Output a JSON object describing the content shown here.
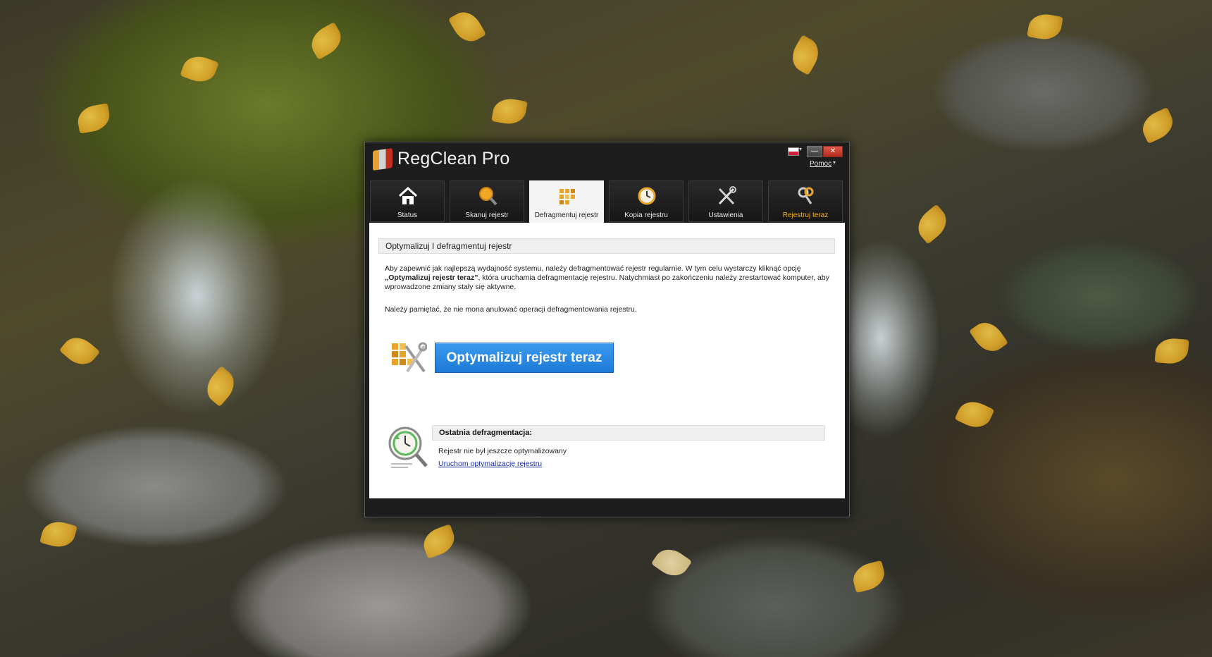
{
  "window": {
    "title": "RegClean Pro",
    "help_label": "Pomoc",
    "language_flag": "polish-flag",
    "controls": {
      "minimize": "—",
      "close": "✕"
    }
  },
  "tabs": [
    {
      "label": "Status",
      "icon": "home-icon",
      "active": false
    },
    {
      "label": "Skanuj rejestr",
      "icon": "magnifier-icon",
      "active": false
    },
    {
      "label": "Defragmentuj rejestr",
      "icon": "defrag-blocks-icon",
      "active": true
    },
    {
      "label": "Kopia rejestru",
      "icon": "clock-icon",
      "active": false
    },
    {
      "label": "Ustawienia",
      "icon": "tools-icon",
      "active": false
    },
    {
      "label": "Rejestruj teraz",
      "icon": "keys-icon",
      "active": false,
      "accent": "#f3b21c"
    }
  ],
  "content": {
    "section_title": "Optymalizuj I defragmentuj rejestr",
    "description_part1": "Aby zapewnić jak najlepszą wydajność systemu, należy defragmentować rejestr regularnie. W tym celu wystarczy kliknąć opcję",
    "description_bold": "„Optymalizuj rejestr teraz”",
    "description_part2": ", która uruchamia defragmentację rejestru. Natychmiast po zakończeniu należy zrestartować komputer, aby wprowadzone zmiany stały się aktywne.",
    "note": "Należy pamiętać, że nie mona anulować operacji defragmentowania rejestru.",
    "primary_button": "Optymalizuj rejestr teraz",
    "last_defrag_title": "Ostatnia defragmentacja:",
    "last_defrag_status": "Rejestr nie był jeszcze optymalizowany",
    "last_defrag_link": "Uruchom optymalizację rejestru"
  },
  "colors": {
    "window_bg": "#1d1d1d",
    "button_blue": "#1e7ad6",
    "accent_orange": "#f3b21c",
    "link_blue": "#1a2fa8"
  }
}
